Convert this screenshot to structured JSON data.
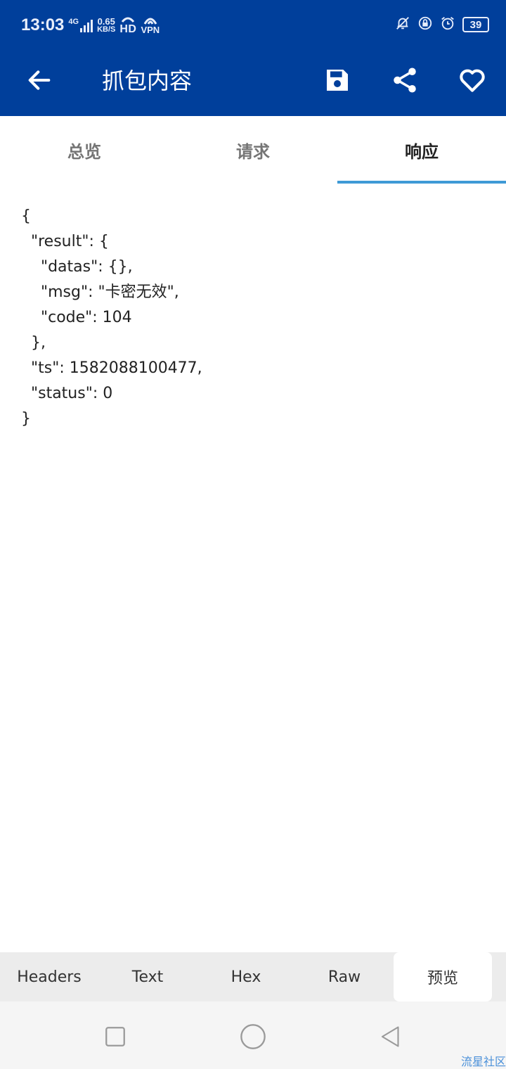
{
  "status_bar": {
    "time": "13:03",
    "network_type": "4G",
    "speed_value": "0.65",
    "speed_unit": "KB/S",
    "hd": "HD",
    "vpn": "VPN",
    "battery": "39"
  },
  "toolbar": {
    "title": "抓包内容"
  },
  "tabs": [
    {
      "label": "总览",
      "active": false
    },
    {
      "label": "请求",
      "active": false
    },
    {
      "label": "响应",
      "active": true
    }
  ],
  "response_body": {
    "lines": [
      "{",
      "  \"result\": {",
      "    \"datas\": {},",
      "    \"msg\": \"卡密无效\",",
      "    \"code\": 104",
      "  },",
      "  \"ts\": 1582088100477,",
      "  \"status\": 0",
      "}"
    ]
  },
  "bottom_tabs": [
    {
      "label": "Headers",
      "active": false
    },
    {
      "label": "Text",
      "active": false
    },
    {
      "label": "Hex",
      "active": false
    },
    {
      "label": "Raw",
      "active": false
    },
    {
      "label": "预览",
      "active": true
    }
  ],
  "watermark": "流星社区",
  "colors": {
    "appbar": "#003f9b",
    "tab_indicator": "#3f9ad6"
  }
}
